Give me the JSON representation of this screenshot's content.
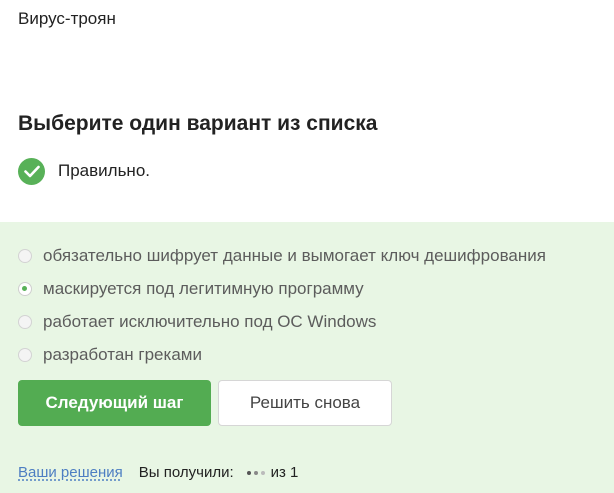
{
  "question": {
    "text": "Вирус-троян"
  },
  "prompt": {
    "title": "Выберите один вариант из списка"
  },
  "feedback": {
    "icon": "checkmark-circle-icon",
    "text": "Правильно.",
    "color": "#58b158"
  },
  "options": [
    {
      "label": "обязательно шифрует данные и вымогает ключ дешифрования",
      "selected": false
    },
    {
      "label": "маскируется под легитимную программу",
      "selected": true
    },
    {
      "label": "работает исключительно под ОС Windows",
      "selected": false
    },
    {
      "label": "разработан греками",
      "selected": false
    }
  ],
  "buttons": {
    "next_label": "Следующий шаг",
    "retry_label": "Решить снова"
  },
  "footer": {
    "solutions_link": "Ваши решения",
    "score_label": "Вы получили:",
    "score_total": "из 1"
  },
  "colors": {
    "accent": "#53ac52",
    "panel": "#e8f6e4",
    "link": "#4d7ec2"
  }
}
